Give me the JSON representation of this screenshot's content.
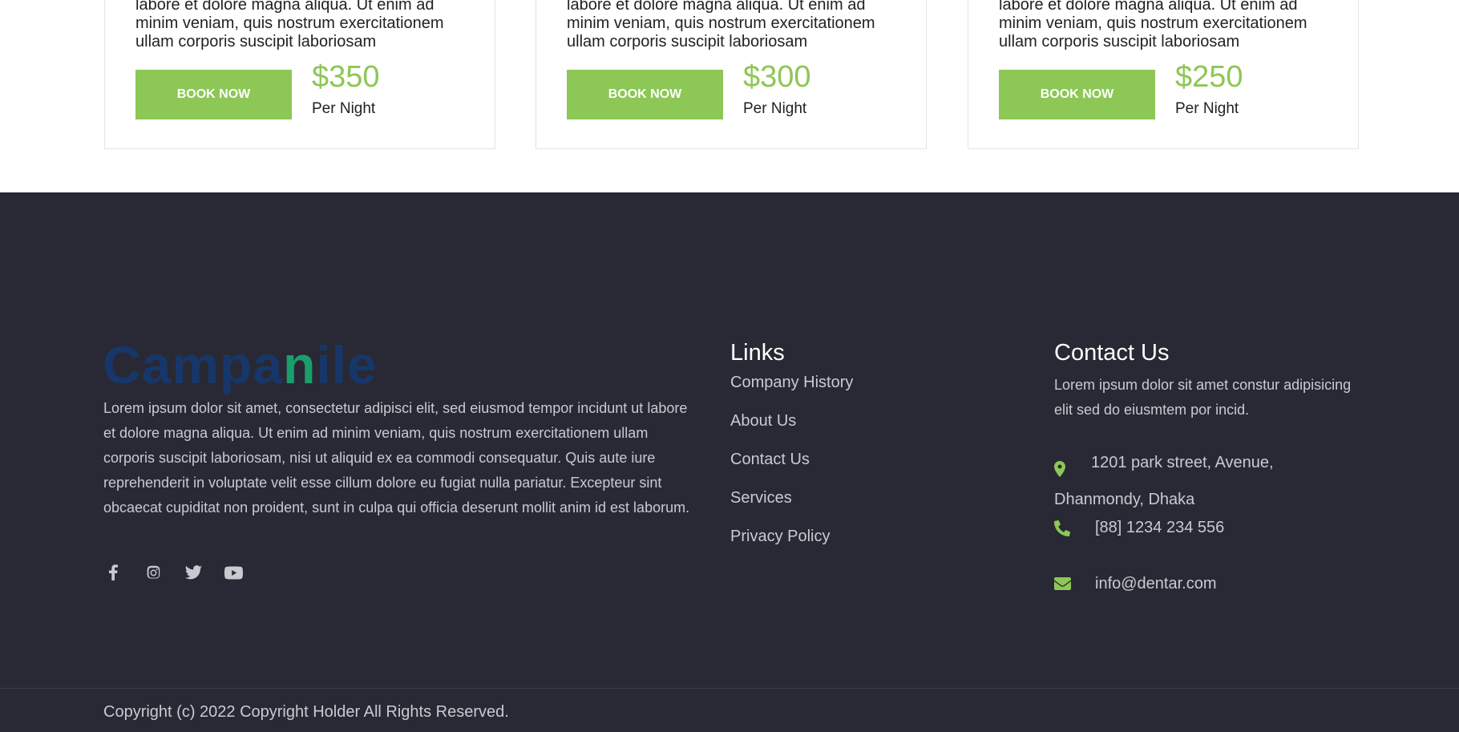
{
  "rooms": [
    {
      "desc": "labore et dolore magna aliqua. Ut enim ad minim veniam, quis nostrum exercitationem ullam corporis suscipit laboriosam",
      "button": "Book Now",
      "price": "$350",
      "unit": "Per Night"
    },
    {
      "desc": "labore et dolore magna aliqua. Ut enim ad minim veniam, quis nostrum exercitationem ullam corporis suscipit laboriosam",
      "button": "Book Now",
      "price": "$300",
      "unit": "Per Night"
    },
    {
      "desc": "labore et dolore magna aliqua. Ut enim ad minim veniam, quis nostrum exercitationem ullam corporis suscipit laboriosam",
      "button": "Book Now",
      "price": "$250",
      "unit": "Per Night"
    }
  ],
  "footer": {
    "logo": {
      "part1": "Campa",
      "house": "n",
      "part2": "ile"
    },
    "about": "Lorem ipsum dolor sit amet, consectetur adipisci elit, sed eiusmod tempor incidunt ut labore et dolore magna aliqua. Ut enim ad minim veniam, quis nostrum exercitationem ullam corporis suscipit laboriosam, nisi ut aliquid ex ea commodi consequatur. Quis aute iure reprehenderit in voluptate velit esse cillum dolore eu fugiat nulla pariatur. Excepteur sint obcaecat cupiditat non proident, sunt in culpa qui officia deserunt mollit anim id est laborum.",
    "social": [
      "facebook-icon",
      "instagram-icon",
      "twitter-icon",
      "youtube-icon"
    ],
    "links": {
      "title": "Links",
      "items": [
        "Company History",
        "About Us",
        "Contact Us",
        "Services",
        "Privacy Policy"
      ]
    },
    "contact": {
      "title": "Contact Us",
      "text": "Lorem ipsum dolor sit amet constur adipisicing elit sed do eiusmtem por incid.",
      "address": "1201 park street, Avenue, Dhanmondy, Dhaka",
      "phone": "[88] 1234 234 556",
      "email": "info@dentar.com"
    },
    "copyright": "Copyright (c) 2022 Copyright Holder All Rights Reserved."
  },
  "colors": {
    "accent": "#8dc755",
    "footer_bg": "#282934",
    "logo_blue": "#17376a",
    "logo_green": "#1a9e6b"
  }
}
